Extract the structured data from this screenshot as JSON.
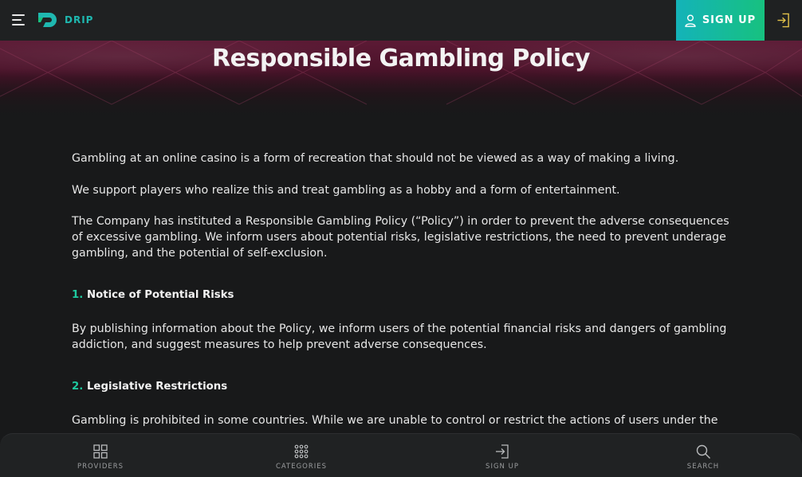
{
  "header": {
    "logo_text": "DRIP",
    "signup_label": "SIGN UP"
  },
  "hero": {
    "title": "Responsible Gambling Policy"
  },
  "content": {
    "paragraphs": [
      "Gambling at an online casino is a form of recreation that should not be viewed as a way of making a living.",
      "We support players who realize this and treat gambling as a hobby and a form of entertainment.",
      "The Company has instituted a Responsible Gambling Policy (“Policy”) in order to prevent the adverse consequences of excessive gambling. We inform users about potential risks, legislative restrictions, the need to prevent underage gambling, and the potential of self-exclusion."
    ],
    "sections": [
      {
        "number": "1.",
        "title": "Notice of Potential Risks",
        "text": "By publishing information about the Policy, we inform users of the potential financial risks and dangers of gambling addiction, and suggest measures to help prevent adverse consequences."
      },
      {
        "number": "2.",
        "title": "Legislative Restrictions",
        "text": "Gambling is prohibited in some countries. While we are unable to control or restrict the actions of users under the"
      }
    ]
  },
  "bottom_nav": {
    "items": [
      {
        "label": "PROVIDERS",
        "icon": "grid-icon"
      },
      {
        "label": "CATEGORIES",
        "icon": "dots-grid-icon"
      },
      {
        "label": "SIGN UP",
        "icon": "sign-in-icon"
      },
      {
        "label": "SEARCH",
        "icon": "search-icon"
      }
    ]
  },
  "colors": {
    "accent": "#1ec99f",
    "signup_gradient_start": "#14b3b9",
    "signup_gradient_end": "#17c17f",
    "login_icon": "#e2c24a",
    "background": "#18191a"
  }
}
